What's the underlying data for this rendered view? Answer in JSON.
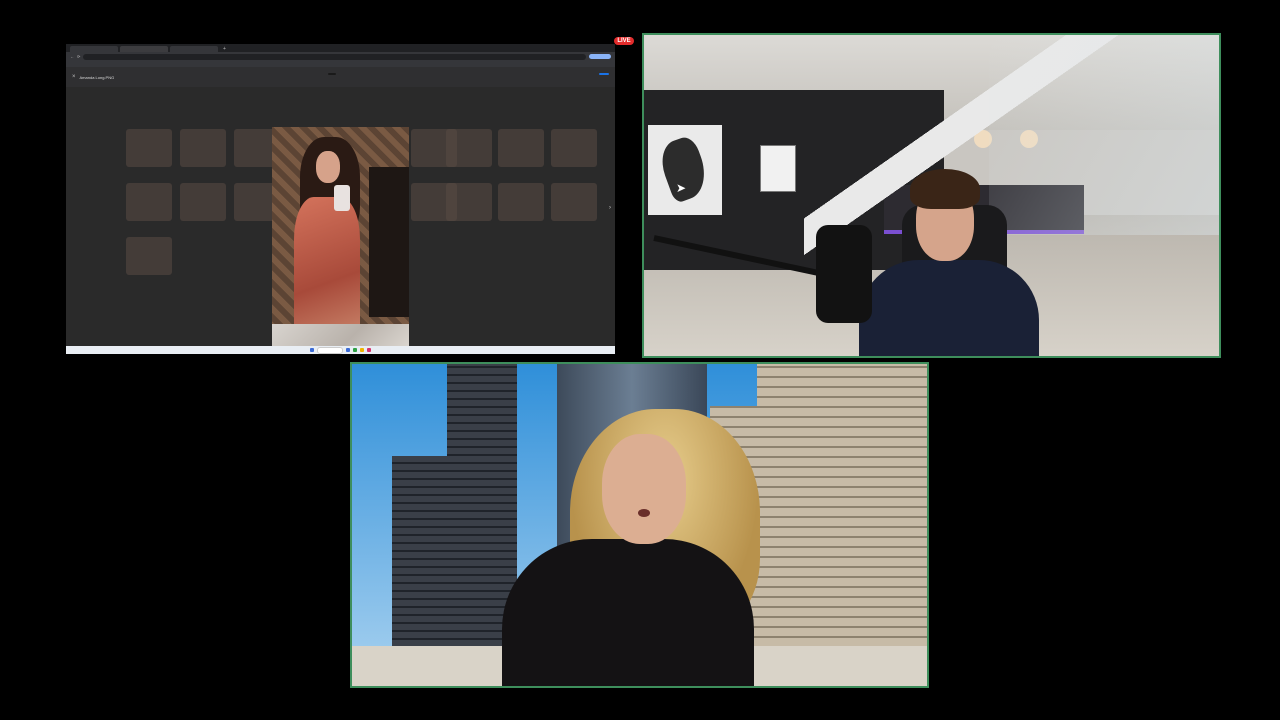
{
  "live_badge": "LIVE",
  "share": {
    "tabs": [
      "",
      "",
      ""
    ],
    "address_url": "",
    "address_button": "",
    "bookmarks": [],
    "viewer_file": "Amanda Long.PNG",
    "viewer_mid": "",
    "viewer_share": "",
    "taskbar_clock": "",
    "taskbar_weather": ""
  },
  "cursor_icon": "arrow-cursor-icon",
  "colors": {
    "active_border": "#3e8e5c",
    "live_red": "#e32c2c"
  }
}
